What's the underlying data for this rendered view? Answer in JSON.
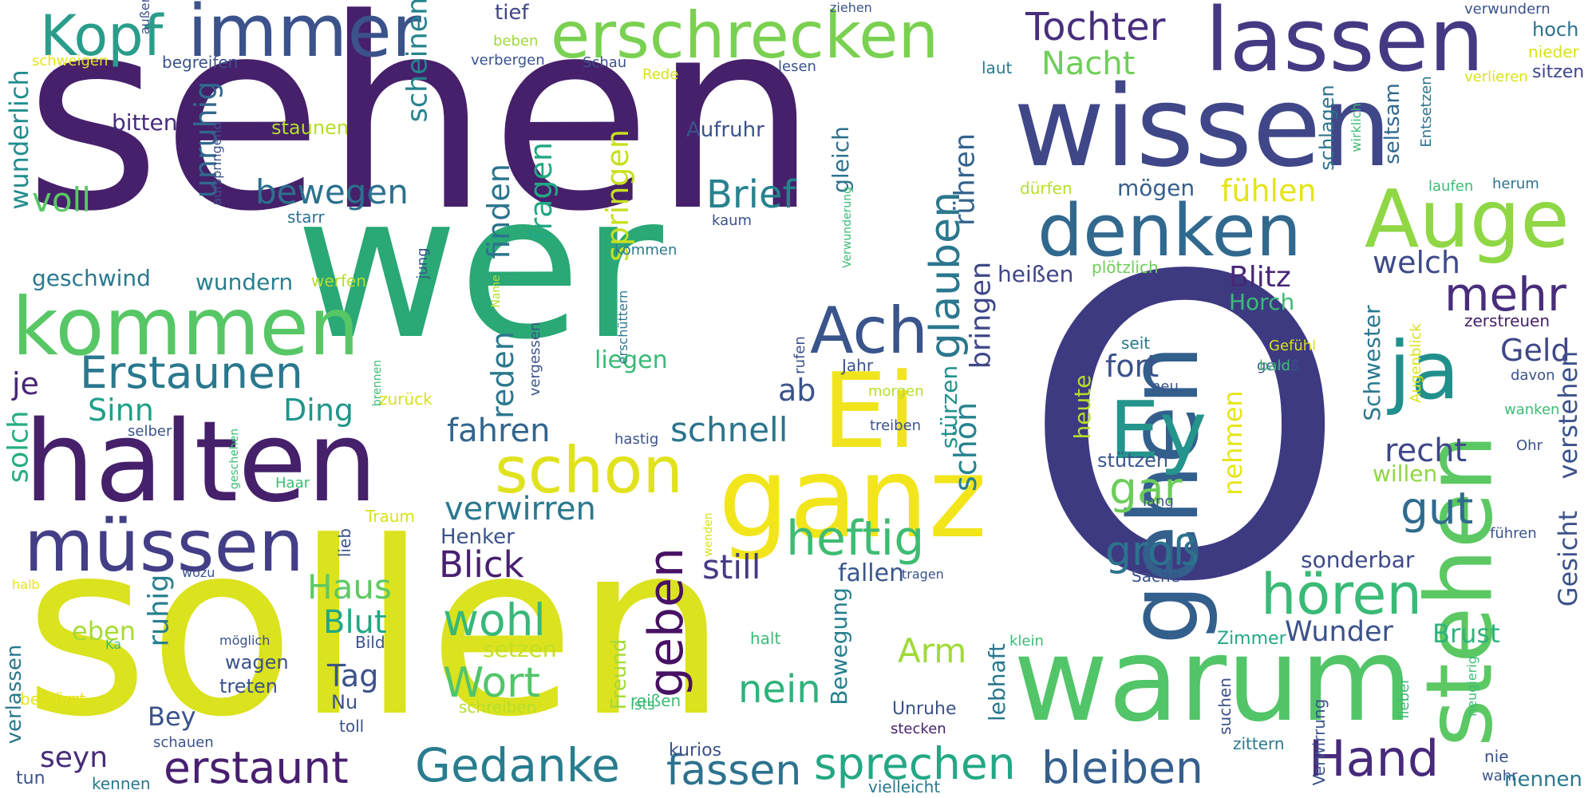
{
  "words": [
    {
      "text": "sehen",
      "color": "#46206b",
      "vertical": false
    },
    {
      "text": "wer",
      "color": "#2aa876",
      "vertical": false
    },
    {
      "text": "O",
      "color": "#3d3a82",
      "vertical": false
    },
    {
      "text": "sollen",
      "color": "#dbe21e",
      "vertical": false
    },
    {
      "text": "wissen",
      "color": "#3f4788",
      "vertical": false
    },
    {
      "text": "warum",
      "color": "#52c569",
      "vertical": false
    },
    {
      "text": "halten",
      "color": "#46206b",
      "vertical": false
    },
    {
      "text": "ganz",
      "color": "#f2e51c",
      "vertical": false
    },
    {
      "text": "gehen",
      "color": "#335f8c",
      "vertical": true
    },
    {
      "text": "stehen",
      "color": "#5cc863",
      "vertical": true
    },
    {
      "text": "kommen",
      "color": "#57c766",
      "vertical": false
    },
    {
      "text": "müssen",
      "color": "#433e85",
      "vertical": false
    },
    {
      "text": "lassen",
      "color": "#443a83",
      "vertical": false
    },
    {
      "text": "erschrecken",
      "color": "#7ad151",
      "vertical": false
    },
    {
      "text": "immer",
      "color": "#3b528b",
      "vertical": false
    },
    {
      "text": "Kopf",
      "color": "#2a9d8a",
      "vertical": false
    },
    {
      "text": "denken",
      "color": "#31688e",
      "vertical": false
    },
    {
      "text": "Auge",
      "color": "#8fd744",
      "vertical": false
    },
    {
      "text": "Ei",
      "color": "#f0e41d",
      "vertical": false
    },
    {
      "text": "Ey",
      "color": "#25948c",
      "vertical": false
    },
    {
      "text": "schon",
      "color": "#e1e21e",
      "vertical": false
    },
    {
      "text": "ja",
      "color": "#21908d",
      "vertical": false
    },
    {
      "text": "Ach",
      "color": "#3a548c",
      "vertical": false
    },
    {
      "text": "heftig",
      "color": "#3ebc73",
      "vertical": false
    },
    {
      "text": "Gedanke",
      "color": "#287d8e",
      "vertical": false
    },
    {
      "text": "erstaunt",
      "color": "#481f70",
      "vertical": false
    },
    {
      "text": "fassen",
      "color": "#2d718e",
      "vertical": false
    },
    {
      "text": "sprechen",
      "color": "#22a884",
      "vertical": false
    },
    {
      "text": "bleiben",
      "color": "#355f8d",
      "vertical": false
    },
    {
      "text": "Hand",
      "color": "#472a7a",
      "vertical": false
    },
    {
      "text": "hören",
      "color": "#3aba76",
      "vertical": false
    },
    {
      "text": "Erstaunen",
      "color": "#2a788e",
      "vertical": false
    },
    {
      "text": "Tochter",
      "color": "#472e7c",
      "vertical": false
    },
    {
      "text": "mehr",
      "color": "#472d7b",
      "vertical": false
    },
    {
      "text": "wohl",
      "color": "#37b878",
      "vertical": false
    },
    {
      "text": "Wort",
      "color": "#52c569",
      "vertical": false
    },
    {
      "text": "gut",
      "color": "#2f6c8e",
      "vertical": false
    },
    {
      "text": "gar",
      "color": "#6ccd5a",
      "vertical": false
    },
    {
      "text": "groß",
      "color": "#2c738e",
      "vertical": false
    },
    {
      "text": "Brief",
      "color": "#26828e",
      "vertical": false
    },
    {
      "text": "geben",
      "color": "#471164",
      "vertical": true
    },
    {
      "text": "glauben",
      "color": "#2a778e",
      "vertical": true
    },
    {
      "text": "Blick",
      "color": "#482071",
      "vertical": false
    },
    {
      "text": "schnell",
      "color": "#2b748e",
      "vertical": false
    },
    {
      "text": "fahren",
      "color": "#32658e",
      "vertical": false
    },
    {
      "text": "verwirren",
      "color": "#2a788e",
      "vertical": false
    },
    {
      "text": "bewegen",
      "color": "#2c718e",
      "vertical": false
    },
    {
      "text": "Nacht",
      "color": "#6ece58",
      "vertical": false
    },
    {
      "text": "Blitz",
      "color": "#482878",
      "vertical": false
    },
    {
      "text": "welch",
      "color": "#3e4a89",
      "vertical": false
    },
    {
      "text": "fühlen",
      "color": "#e5e419",
      "vertical": false
    },
    {
      "text": "fort",
      "color": "#3b528b",
      "vertical": false
    },
    {
      "text": "recht",
      "color": "#3f4788",
      "vertical": false
    },
    {
      "text": "Geld",
      "color": "#3f4788",
      "vertical": false
    },
    {
      "text": "nein",
      "color": "#2eb37c",
      "vertical": false
    },
    {
      "text": "Arm",
      "color": "#a0da39",
      "vertical": false
    },
    {
      "text": "Wunder",
      "color": "#3b528b",
      "vertical": false
    },
    {
      "text": "Brust",
      "color": "#2db27d",
      "vertical": false
    },
    {
      "text": "Haus",
      "color": "#5ec962",
      "vertical": false
    },
    {
      "text": "Blut",
      "color": "#22a785",
      "vertical": false
    },
    {
      "text": "Tag",
      "color": "#3b528b",
      "vertical": false
    },
    {
      "text": "still",
      "color": "#443b84",
      "vertical": false
    },
    {
      "text": "Ding",
      "color": "#1f958b",
      "vertical": false
    },
    {
      "text": "Sinn",
      "color": "#1fa088",
      "vertical": false
    },
    {
      "text": "voll",
      "color": "#5ac864",
      "vertical": false
    },
    {
      "text": "je",
      "color": "#482677",
      "vertical": false
    },
    {
      "text": "ab",
      "color": "#3b528b",
      "vertical": false
    },
    {
      "text": "seyn",
      "color": "#472c7a",
      "vertical": false
    },
    {
      "text": "Bey",
      "color": "#3b528b",
      "vertical": false
    },
    {
      "text": "eben",
      "color": "#a8db34",
      "vertical": false
    },
    {
      "text": "heißen",
      "color": "#404588",
      "vertical": false
    },
    {
      "text": "mögen",
      "color": "#355f8d",
      "vertical": false
    },
    {
      "text": "sonderbar",
      "color": "#3e4989",
      "vertical": false
    },
    {
      "text": "willen",
      "color": "#90d743",
      "vertical": false
    },
    {
      "text": "stützen",
      "color": "#39568c",
      "vertical": false
    },
    {
      "text": "wundern",
      "color": "#277f8e",
      "vertical": false
    },
    {
      "text": "geschwind",
      "color": "#2a788e",
      "vertical": false
    },
    {
      "text": "setzen",
      "color": "#c2df23",
      "vertical": false
    },
    {
      "text": "liegen",
      "color": "#3aba76",
      "vertical": false
    },
    {
      "text": "fallen",
      "color": "#39568c",
      "vertical": false
    },
    {
      "text": "bitten",
      "color": "#472d7b",
      "vertical": false
    },
    {
      "text": "Aufruhr",
      "color": "#3b528b",
      "vertical": false
    },
    {
      "text": "staunen",
      "color": "#b5de2b",
      "vertical": false
    },
    {
      "text": "finden",
      "color": "#2b748e",
      "vertical": true
    },
    {
      "text": "fragen",
      "color": "#22a884",
      "vertical": true
    },
    {
      "text": "springen",
      "color": "#c8e020",
      "vertical": true
    },
    {
      "text": "scheinen",
      "color": "#25848e",
      "vertical": true
    },
    {
      "text": "unruhig",
      "color": "#31688e",
      "vertical": true
    },
    {
      "text": "wunderlich",
      "color": "#228d8d",
      "vertical": true
    },
    {
      "text": "solch",
      "color": "#27ad81",
      "vertical": true
    },
    {
      "text": "ruhig",
      "color": "#277f8e",
      "vertical": true
    },
    {
      "text": "reden",
      "color": "#2a788e",
      "vertical": true
    },
    {
      "text": "bringen",
      "color": "#3f4788",
      "vertical": true
    },
    {
      "text": "rühren",
      "color": "#33638d",
      "vertical": true
    },
    {
      "text": "schön",
      "color": "#26828e",
      "vertical": true
    },
    {
      "text": "stürzen",
      "color": "#20928c",
      "vertical": true
    },
    {
      "text": "Bewegung",
      "color": "#277f8e",
      "vertical": true
    },
    {
      "text": "lebhaft",
      "color": "#2a788e",
      "vertical": true
    },
    {
      "text": "gleich",
      "color": "#2c728e",
      "vertical": true
    },
    {
      "text": "Gesicht",
      "color": "#3b528b",
      "vertical": true
    },
    {
      "text": "verstehen",
      "color": "#3b528b",
      "vertical": true
    },
    {
      "text": "nehmen",
      "color": "#e7e419",
      "vertical": true
    },
    {
      "text": "heute",
      "color": "#b5de2b",
      "vertical": true
    },
    {
      "text": "Schwester",
      "color": "#2a788e",
      "vertical": true
    },
    {
      "text": "Horch",
      "color": "#3cbb75",
      "vertical": false
    },
    {
      "text": "verlassen",
      "color": "#2a788e",
      "vertical": true
    },
    {
      "text": "Freund",
      "color": "#a5db36",
      "vertical": true
    },
    {
      "text": "schlagen",
      "color": "#2c728e",
      "vertical": true
    },
    {
      "text": "seltsam",
      "color": "#31688e",
      "vertical": true
    },
    {
      "text": "Henker",
      "color": "#3b528b",
      "vertical": false
    },
    {
      "text": "Zimmer",
      "color": "#22a785",
      "vertical": false
    },
    {
      "text": "tief",
      "color": "#414487",
      "vertical": false
    },
    {
      "text": "hoch",
      "color": "#2c728e",
      "vertical": false
    },
    {
      "text": "nieder",
      "color": "#d8e219",
      "vertical": false
    },
    {
      "text": "sitzen",
      "color": "#3f4788",
      "vertical": false
    },
    {
      "text": "verwundern",
      "color": "#3b528b",
      "vertical": false
    },
    {
      "text": "laut",
      "color": "#2a788e",
      "vertical": false
    },
    {
      "text": "lesen",
      "color": "#3b528b",
      "vertical": false
    },
    {
      "text": "beben",
      "color": "#a0da39",
      "vertical": false
    },
    {
      "text": "verbergen",
      "color": "#3b528b",
      "vertical": false
    },
    {
      "text": "Schau",
      "color": "#3b528b",
      "vertical": false
    },
    {
      "text": "Rede",
      "color": "#d8e219",
      "vertical": false
    },
    {
      "text": "ziehen",
      "color": "#3b528b",
      "vertical": false
    },
    {
      "text": "begreifen",
      "color": "#3b528b",
      "vertical": false
    },
    {
      "text": "schweigen",
      "color": "#e5e419",
      "vertical": false
    },
    {
      "text": "verlieren",
      "color": "#d8e219",
      "vertical": false
    },
    {
      "text": "starr",
      "color": "#2c728e",
      "vertical": false
    },
    {
      "text": "kaum",
      "color": "#3b528b",
      "vertical": false
    },
    {
      "text": "kömmen",
      "color": "#2a788e",
      "vertical": false
    },
    {
      "text": "dürfen",
      "color": "#b5de2b",
      "vertical": false
    },
    {
      "text": "laufen",
      "color": "#3cbb75",
      "vertical": false
    },
    {
      "text": "herum",
      "color": "#2c728e",
      "vertical": false
    },
    {
      "text": "plötzlich",
      "color": "#6ece58",
      "vertical": false
    },
    {
      "text": "werfen",
      "color": "#b5de2b",
      "vertical": false
    },
    {
      "text": "Gefühl",
      "color": "#d8e219",
      "vertical": false
    },
    {
      "text": "gewiß",
      "color": "#3b528b",
      "vertical": false
    },
    {
      "text": "zerstreuen",
      "color": "#46206b",
      "vertical": false
    },
    {
      "text": "seit",
      "color": "#2a788e",
      "vertical": false
    },
    {
      "text": "neu",
      "color": "#3b528b",
      "vertical": false
    },
    {
      "text": "bald",
      "color": "#3cbb75",
      "vertical": false
    },
    {
      "text": "davon",
      "color": "#3b528b",
      "vertical": false
    },
    {
      "text": "wanken",
      "color": "#3cbb75",
      "vertical": false
    },
    {
      "text": "Ohr",
      "color": "#3b528b",
      "vertical": false
    },
    {
      "text": "Jahr",
      "color": "#3b528b",
      "vertical": false
    },
    {
      "text": "morgen",
      "color": "#b5de2b",
      "vertical": false
    },
    {
      "text": "treiben",
      "color": "#3b528b",
      "vertical": false
    },
    {
      "text": "hastig",
      "color": "#3b528b",
      "vertical": false
    },
    {
      "text": "zurück",
      "color": "#d8e219",
      "vertical": false
    },
    {
      "text": "selber",
      "color": "#3b528b",
      "vertical": false
    },
    {
      "text": "Haar",
      "color": "#3cbb75",
      "vertical": false
    },
    {
      "text": "Traum",
      "color": "#d8e219",
      "vertical": false
    },
    {
      "text": "lang",
      "color": "#3b528b",
      "vertical": false
    },
    {
      "text": "führen",
      "color": "#3b528b",
      "vertical": false
    },
    {
      "text": "Sache",
      "color": "#3b528b",
      "vertical": false
    },
    {
      "text": "tragen",
      "color": "#3b528b",
      "vertical": false
    },
    {
      "text": "halb",
      "color": "#e5e419",
      "vertical": false
    },
    {
      "text": "wozu",
      "color": "#3b528b",
      "vertical": false
    },
    {
      "text": "möglich",
      "color": "#3b528b",
      "vertical": false
    },
    {
      "text": "Ka",
      "color": "#3cbb75",
      "vertical": false
    },
    {
      "text": "Bild",
      "color": "#3b528b",
      "vertical": false
    },
    {
      "text": "wagen",
      "color": "#3b528b",
      "vertical": false
    },
    {
      "text": "treten",
      "color": "#3b528b",
      "vertical": false
    },
    {
      "text": "halt",
      "color": "#3cbb75",
      "vertical": false
    },
    {
      "text": "reißen",
      "color": "#3cbb75",
      "vertical": false
    },
    {
      "text": "ists",
      "color": "#3cbb75",
      "vertical": false
    },
    {
      "text": "schreiben",
      "color": "#b5de2b",
      "vertical": false
    },
    {
      "text": "Nu",
      "color": "#3b528b",
      "vertical": false
    },
    {
      "text": "toll",
      "color": "#3b528b",
      "vertical": false
    },
    {
      "text": "bestürzt",
      "color": "#e5e419",
      "vertical": false
    },
    {
      "text": "schauen",
      "color": "#3b528b",
      "vertical": false
    },
    {
      "text": "tun",
      "color": "#3b528b",
      "vertical": false
    },
    {
      "text": "kennen",
      "color": "#2a788e",
      "vertical": false
    },
    {
      "text": "kurios",
      "color": "#3b528b",
      "vertical": false
    },
    {
      "text": "vielleicht",
      "color": "#2a788e",
      "vertical": false
    },
    {
      "text": "Unruhe",
      "color": "#3b528b",
      "vertical": false
    },
    {
      "text": "stecken",
      "color": "#46206b",
      "vertical": false
    },
    {
      "text": "klein",
      "color": "#3cbb75",
      "vertical": false
    },
    {
      "text": "zittern",
      "color": "#2a788e",
      "vertical": false
    },
    {
      "text": "nie",
      "color": "#3b528b",
      "vertical": false
    },
    {
      "text": "wahr",
      "color": "#3b528b",
      "vertical": false
    },
    {
      "text": "nennen",
      "color": "#2a788e",
      "vertical": false
    },
    {
      "text": "Verwirrung",
      "color": "#3b528b",
      "vertical": true
    },
    {
      "text": "suchen",
      "color": "#3b528b",
      "vertical": true
    },
    {
      "text": "lieber",
      "color": "#3cbb75",
      "vertical": true
    },
    {
      "text": "neugierig",
      "color": "#3cbb75",
      "vertical": true
    },
    {
      "text": "Augenblick",
      "color": "#d8e219",
      "vertical": true
    },
    {
      "text": "wirklich",
      "color": "#3cbb75",
      "vertical": true
    },
    {
      "text": "Entsetzen",
      "color": "#2c728e",
      "vertical": true
    },
    {
      "text": "außer",
      "color": "#3b528b",
      "vertical": true
    },
    {
      "text": "aufspringend",
      "color": "#3b528b",
      "vertical": true
    },
    {
      "text": "jung",
      "color": "#3b528b",
      "vertical": true
    },
    {
      "text": "Name",
      "color": "#b5de2b",
      "vertical": true
    },
    {
      "text": "vergessen",
      "color": "#3b528b",
      "vertical": true
    },
    {
      "text": "erschüttern",
      "color": "#2a788e",
      "vertical": true
    },
    {
      "text": "rufen",
      "color": "#3b528b",
      "vertical": true
    },
    {
      "text": "Verwunderung",
      "color": "#3cbb75",
      "vertical": true
    },
    {
      "text": "brennen",
      "color": "#3cbb75",
      "vertical": true
    },
    {
      "text": "geschehen",
      "color": "#3cbb75",
      "vertical": true
    },
    {
      "text": "lieb",
      "color": "#3b528b",
      "vertical": true
    },
    {
      "text": "wenden",
      "color": "#d8e219",
      "vertical": true
    }
  ]
}
